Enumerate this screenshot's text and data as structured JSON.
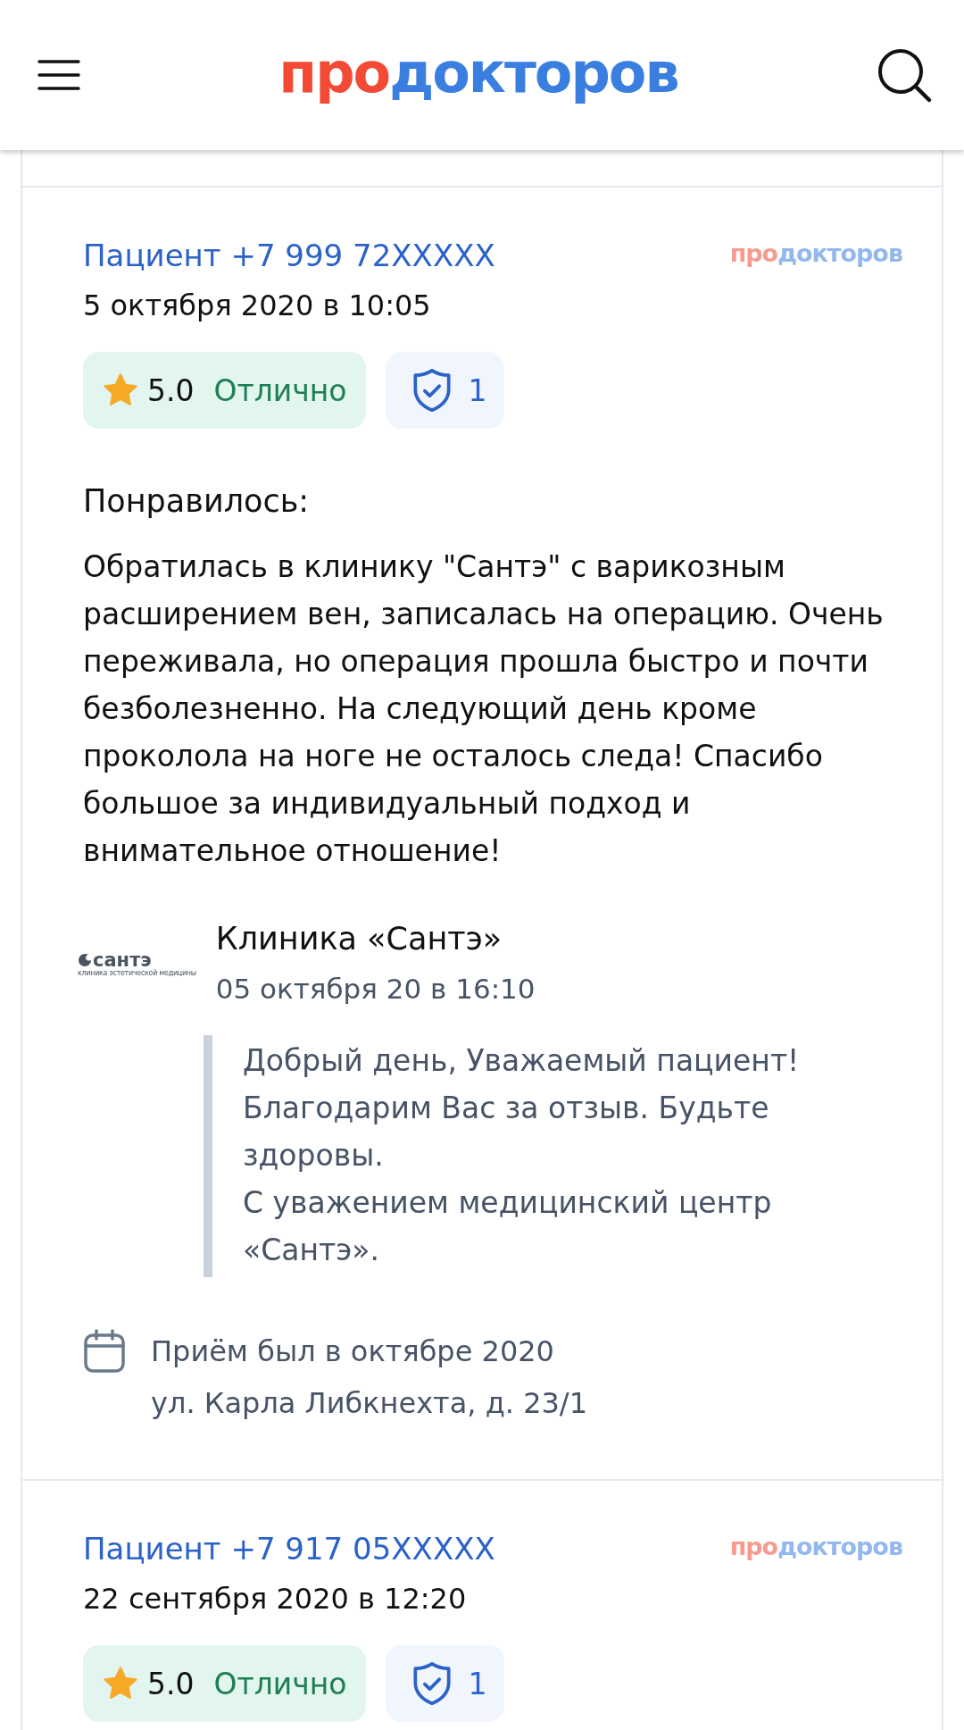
{
  "header": {
    "logo": {
      "accent": "про",
      "rest": "докторов"
    }
  },
  "reviews": [
    {
      "author": "Пациент +7 999 72XXXXX",
      "date": "5 октября 2020 в 10:05",
      "source": {
        "accent": "про",
        "rest": "докторов"
      },
      "rating": {
        "value": "5.0",
        "label": "Отлично"
      },
      "verified_count": "1",
      "sections": [
        {
          "heading": "Понравилось:",
          "text": "Обратилась в клинику \"Сантэ\" с варикозным расширением вен, записалась на операцию. Очень переживала, но операция прошла быстро и почти безболезненно. На следующий день кроме проколола на ноге не осталось следа! Спасибо большое за индивидуальный подход и внимательное отношение!"
        }
      ],
      "reply": {
        "logo": {
          "name": "сантэ",
          "tagline": "клиника эстетической медицины"
        },
        "title": "Клиника «Сантэ»",
        "date": "05 октября 20 в 16:10",
        "paragraphs": [
          "Добрый день, Уважаемый пациент!",
          "Благодарим Вас за отзыв. Будьте здоровы.",
          "С уважением медицинский центр «Сантэ»."
        ]
      },
      "visit": {
        "when": "Приём был в октябре 2020",
        "address": "ул. Карла Либкнехта, д. 23/1"
      }
    },
    {
      "author": "Пациент +7 917 05XXXXX",
      "date": "22 сентября 2020 в 12:20",
      "source": {
        "accent": "про",
        "rest": "докторов"
      },
      "rating": {
        "value": "5.0",
        "label": "Отлично"
      },
      "verified_count": "1"
    }
  ]
}
